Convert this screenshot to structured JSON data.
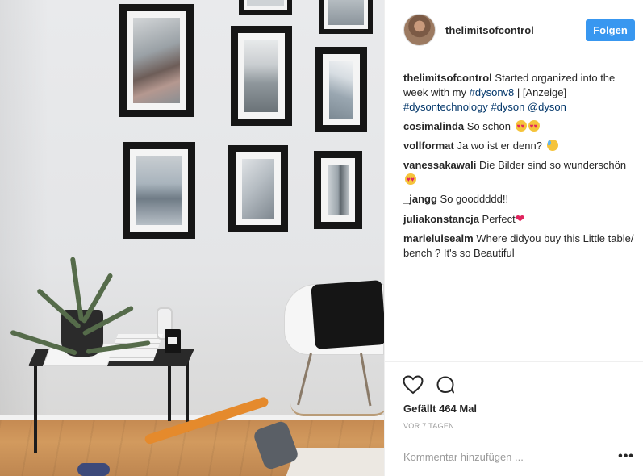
{
  "post": {
    "username": "thelimitsofcontrol",
    "follow_label": "Folgen",
    "caption": {
      "user": "thelimitsofcontrol",
      "text_before": " Started organized into the week with my ",
      "tag1": "#dysonv8",
      "text_mid": " | [Anzeige] ",
      "tag2": "#dysontechnology",
      "space": " ",
      "tag3": "#dyson",
      "tag4": "@dyson"
    },
    "comments": [
      {
        "user": "cosimalinda",
        "text": " So schön ",
        "emoji": "heart-eyes"
      },
      {
        "user": "vollformat",
        "text": " Ja wo ist er denn? ",
        "emoji": "sweat-smile"
      },
      {
        "user": "vanessakawali",
        "text": " Die Bilder sind so wunderschön ",
        "emoji": "heart-eyes"
      },
      {
        "user": "_jangg",
        "text": " So gooddddd!!"
      },
      {
        "user": "juliakonstancja",
        "text": " Perfect",
        "emoji": "red-heart"
      },
      {
        "user": "marieluisealm",
        "text": " Where didyou buy this Little table/ bench ? It's so Beautiful"
      }
    ],
    "likes": "Gefällt 464 Mal",
    "time_ago": "VOR 7 TAGEN",
    "comment_placeholder": "Kommentar hinzufügen ...",
    "more_label": "•••"
  },
  "colors": {
    "accent": "#3897f0",
    "text": "#262626",
    "link": "#003569",
    "muted": "#999999"
  }
}
